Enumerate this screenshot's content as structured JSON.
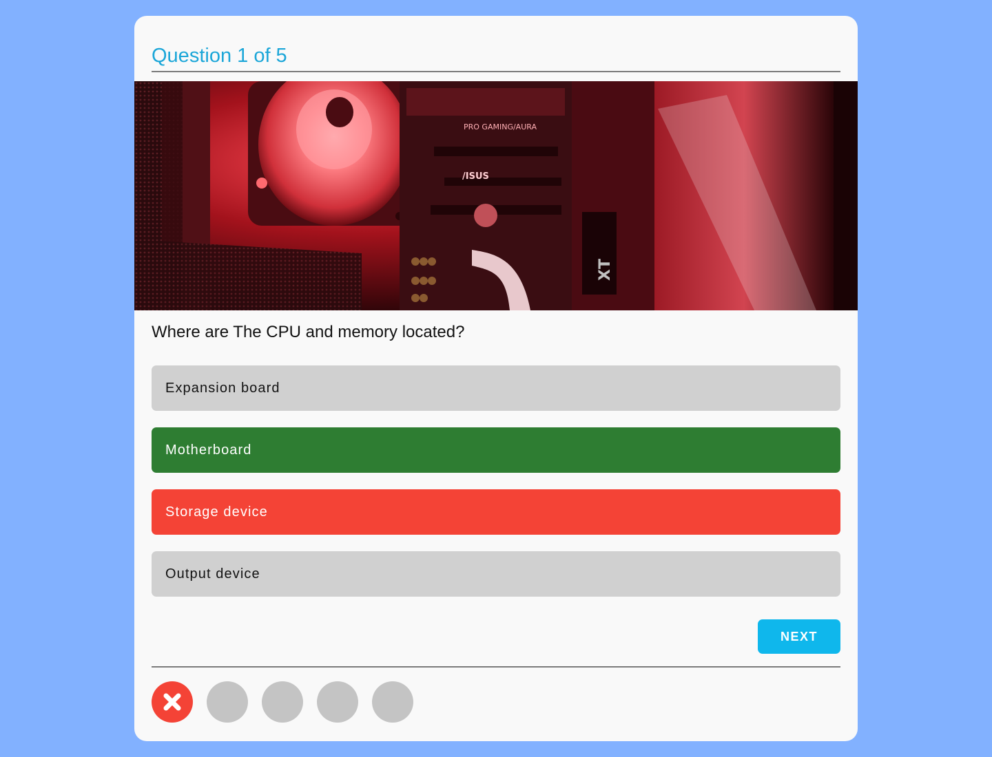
{
  "quiz": {
    "title": "Question 1 of 5",
    "question": "Where are The CPU and memory located?",
    "image": {
      "icon": "computer-motherboard-photo",
      "dominant_color": "#e0323c",
      "labels": [
        "PRO GAMING/AURA",
        "/ISUS",
        "XT"
      ]
    },
    "options": [
      {
        "label": "Expansion board",
        "state": "neutral"
      },
      {
        "label": "Motherboard",
        "state": "correct"
      },
      {
        "label": "Storage device",
        "state": "wrong"
      },
      {
        "label": "Output device",
        "state": "neutral"
      }
    ],
    "next_label": "NEXT",
    "progress": [
      {
        "state": "wrong",
        "icon": "close-icon"
      },
      {
        "state": "pending"
      },
      {
        "state": "pending"
      },
      {
        "state": "pending"
      },
      {
        "state": "pending"
      }
    ]
  },
  "colors": {
    "background": "#82b1ff",
    "accent": "#1ba6d8",
    "correct": "#2e7d32",
    "wrong": "#f44336",
    "neutral": "#d0d0d0",
    "next_button": "#0fb7ec"
  }
}
